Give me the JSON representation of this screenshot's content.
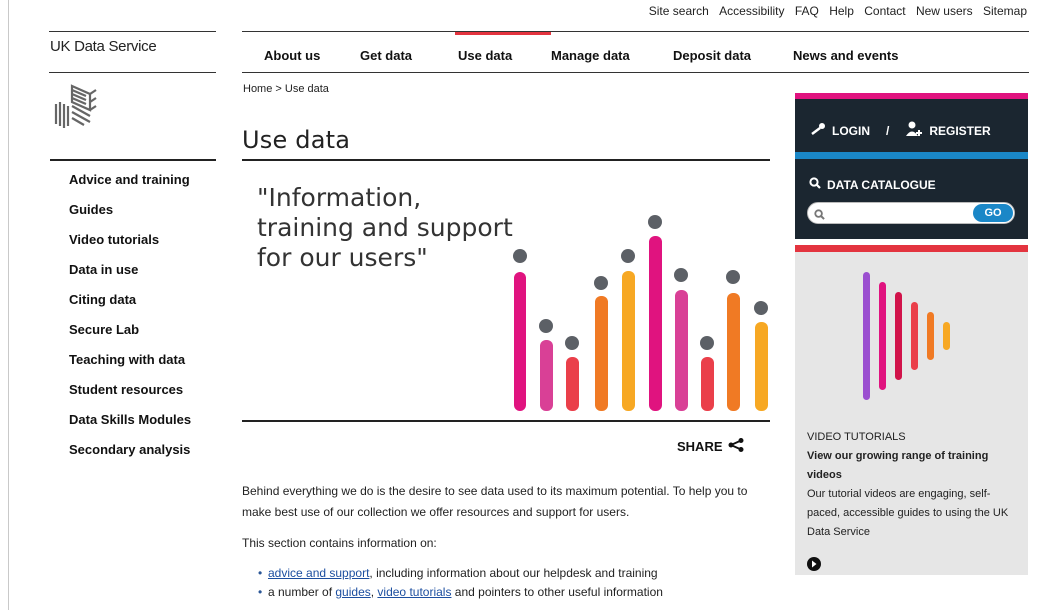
{
  "utility_nav": [
    "Site search",
    "Accessibility",
    "FAQ",
    "Help",
    "Contact",
    "New users",
    "Sitemap"
  ],
  "brand": {
    "name": "UK Data Service"
  },
  "main_nav": [
    {
      "label": "About us"
    },
    {
      "label": "Get data"
    },
    {
      "label": "Use data",
      "active": true
    },
    {
      "label": "Manage data"
    },
    {
      "label": "Deposit data"
    },
    {
      "label": "News and events"
    }
  ],
  "breadcrumb": "Home > Use data",
  "page_title": "Use data",
  "hero": {
    "quote_line1": "\"Information,",
    "quote_line2": "training and support",
    "quote_line3": "for our users\""
  },
  "sidebar": {
    "items": [
      {
        "label": "Advice and training"
      },
      {
        "label": "Guides"
      },
      {
        "label": "Video tutorials"
      },
      {
        "label": "Data in use"
      },
      {
        "label": "Citing data"
      },
      {
        "label": "Secure Lab"
      },
      {
        "label": "Teaching with data"
      },
      {
        "label": "Student resources"
      },
      {
        "label": "Data Skills Modules"
      },
      {
        "label": "Secondary analysis"
      }
    ]
  },
  "share": {
    "label": "SHARE",
    "icon": "share-icon"
  },
  "body": {
    "para1": "Behind everything we do is the desire to see data used to its maximum potential. To help you to make best use of our collection we offer resources and support for users.",
    "para2": "This section contains information on:",
    "bullet1_link": "advice and support",
    "bullet1_rest": ", including information about our helpdesk and training",
    "bullet2_pre": "a number of ",
    "bullet2_link1": "guides",
    "bullet2_sep": ", ",
    "bullet2_link2": "video tutorials",
    "bullet2_rest": " and pointers to other useful information"
  },
  "login": {
    "login_label": "LOGIN",
    "separator": "/",
    "register_label": "REGISTER"
  },
  "catalogue": {
    "title": "DATA CATALOGUE",
    "search_value": "",
    "go_label": "GO"
  },
  "video_promo": {
    "kicker": "VIDEO TUTORIALS",
    "heading": "View our growing range of training videos",
    "text": "Our tutorial videos are engaging, self-paced, accessible guides to using the UK Data Service"
  },
  "colors": {
    "accent_red": "#e3343f",
    "magenta": "#e0137f",
    "blue": "#1a87c7",
    "dark_panel": "#1b2630"
  }
}
